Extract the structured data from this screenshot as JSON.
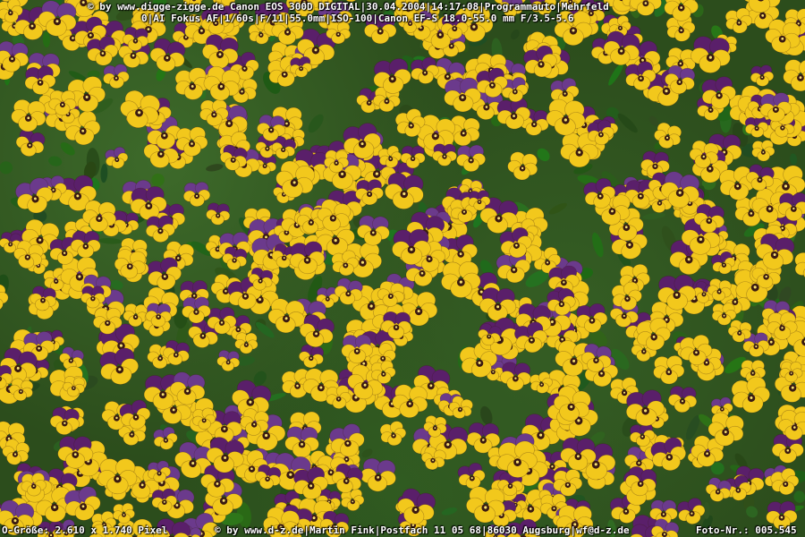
{
  "image": {
    "subject": "pansy-field",
    "colors": {
      "foliage": "#2c4d1c",
      "petal_yellow": "#f2c81c",
      "petal_purple": "#5a1f6a",
      "petal_violet": "#6b3a8c",
      "center_dark": "#3a1a12"
    }
  },
  "overlay": {
    "top_line_1": "© by www.digge-zigge.de Canon EOS 300D DIGITAL|30.04.2004|14:17:08|Programmauto|Mehrfeld",
    "top_line_2": "0|AI Fokus AF|1/60s|F/11|55.0mm|ISO-100|Canon EF-S 18.0-55.0 mm F/3.5-5.6",
    "bottom_left": "O-Größe: 2.610 x 1.740 Pixel",
    "bottom_mid": "© by www.d-z.de|Martin Fink|Postfach 11 05 68|86030 Augsburg|wf@d-z.de",
    "bottom_right": "Foto-Nr.: 005.545"
  }
}
